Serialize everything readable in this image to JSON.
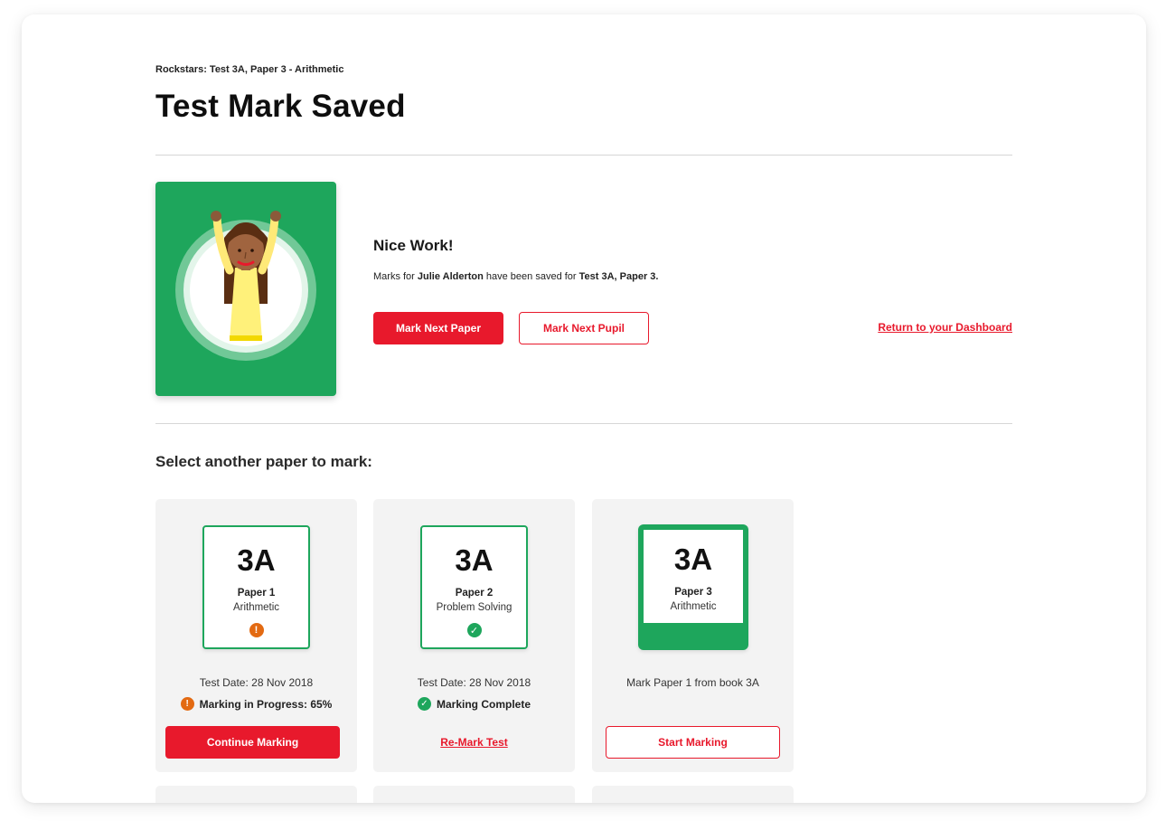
{
  "header": {
    "breadcrumb": "Rockstars: Test 3A, Paper 3 - Arithmetic",
    "title": "Test Mark Saved"
  },
  "success": {
    "heading": "Nice Work!",
    "msg_prefix": "Marks for ",
    "pupil_name": "Julie Alderton",
    "msg_middle": " have been saved for ",
    "test_name": "Test 3A, Paper 3.",
    "mark_next_paper": "Mark Next Paper",
    "mark_next_pupil": "Mark Next Pupil",
    "return_dashboard": "Return to your Dashboard"
  },
  "papers_section": {
    "title": "Select another paper to mark:",
    "cards": [
      {
        "book_code": "3A",
        "paper": "Paper 1",
        "subject": "Arithmetic",
        "status_icon": "warning-icon",
        "date": "Test Date: 28 Nov 2018",
        "status": "Marking in Progress: 65%",
        "progress_percent": 65,
        "action": "Continue Marking"
      },
      {
        "book_code": "3A",
        "paper": "Paper 2",
        "subject": "Problem Solving",
        "status_icon": "check-icon",
        "date": "Test Date: 28 Nov 2018",
        "status": "Marking Complete",
        "action": "Re-Mark Test"
      },
      {
        "book_code": "3A",
        "paper": "Paper 3",
        "subject": "Arithmetic",
        "note": "Mark Paper 1 from book 3A",
        "action": "Start Marking"
      }
    ]
  },
  "colors": {
    "brand_red": "#e8192c",
    "green": "#1ea65c",
    "warning_orange": "#e36a12",
    "card_bg": "#f3f3f3"
  }
}
